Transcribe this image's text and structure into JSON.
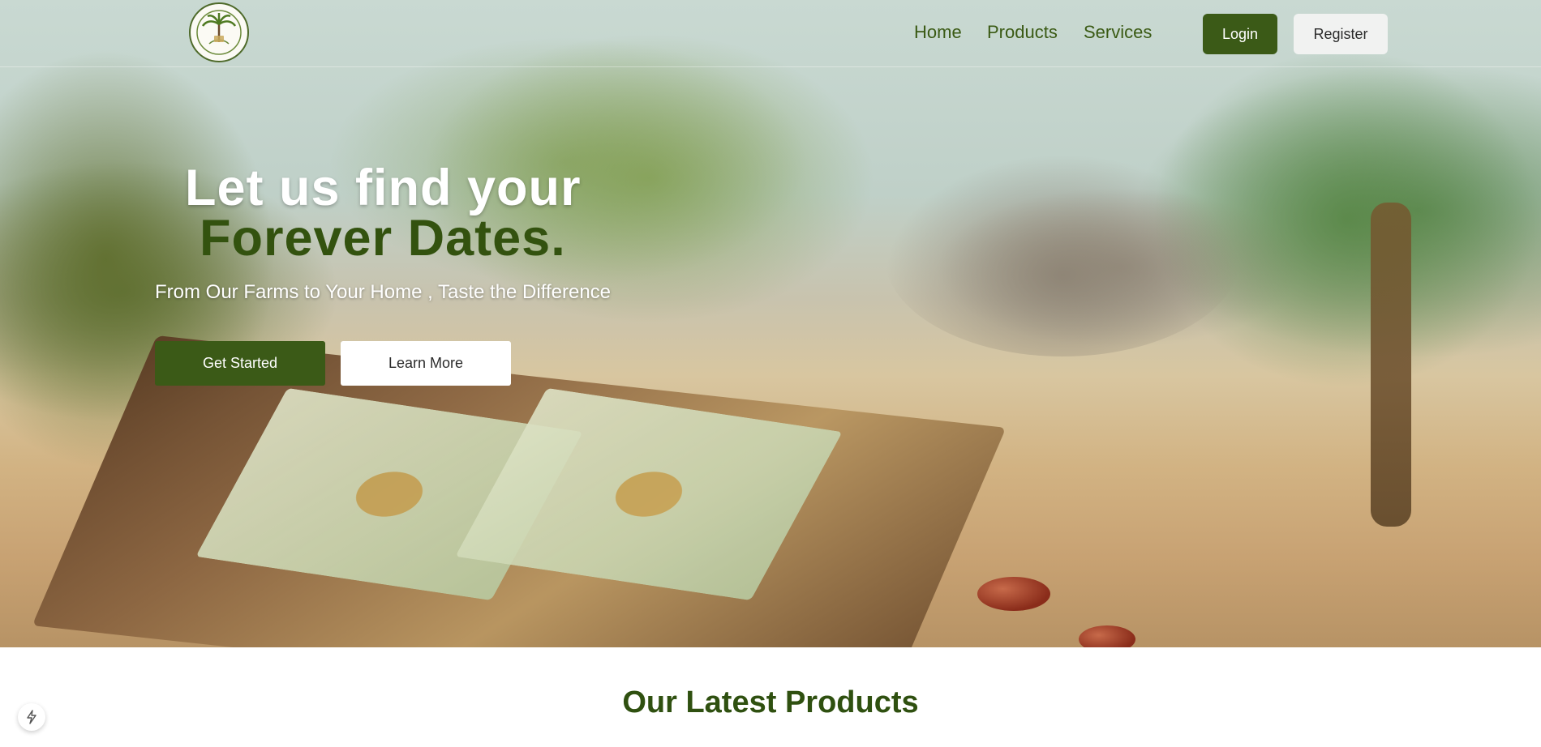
{
  "nav": {
    "links": [
      "Home",
      "Products",
      "Services"
    ],
    "login_label": "Login",
    "register_label": "Register"
  },
  "hero": {
    "headline_line1": "Let us find your",
    "headline_line2": "Forever Dates.",
    "subheadline": "From Our Farms to Your Home , Taste the Difference",
    "primary_button": "Get Started",
    "secondary_button": "Learn More"
  },
  "products_section": {
    "title": "Our Latest Products"
  },
  "icons": {
    "logo": "palm-tree-logo-icon",
    "floating": "lightning-bolt-icon"
  },
  "colors": {
    "brand_green": "#3b5a17",
    "title_green": "#2f5010",
    "nav_text": "#3a5a14"
  }
}
